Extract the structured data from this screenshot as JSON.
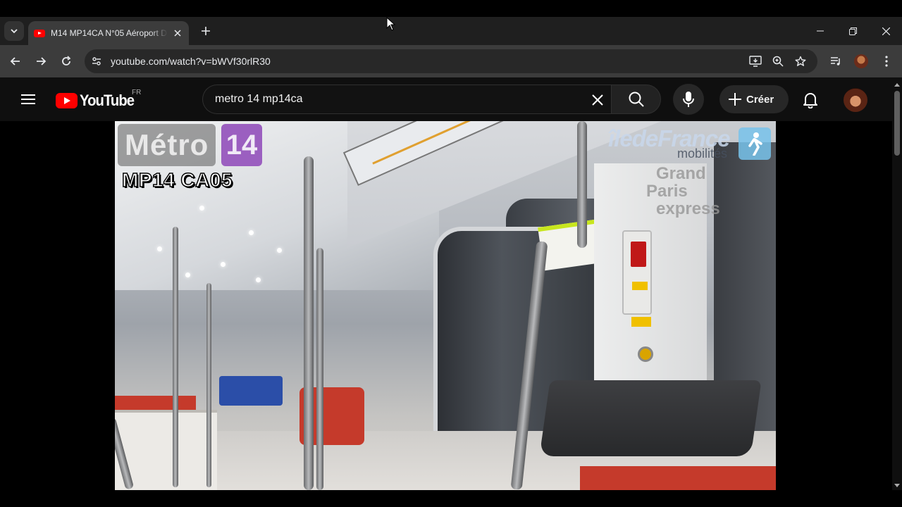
{
  "browser": {
    "tab_title": "M14 MP14CA N°05 Aéroport D",
    "url": "youtube.com/watch?v=bWVf30rlR30"
  },
  "youtube": {
    "logo_text": "YouTube",
    "region": "FR",
    "search_query": "metro 14 mp14ca",
    "create_label": "Créer"
  },
  "video": {
    "overlay_title": "Métro",
    "overlay_line": "14",
    "overlay_code": "MP14 CA05",
    "logo_brand": "îledeFrance",
    "logo_sub": "mobilités",
    "logo_gpe": [
      "Grand",
      "Paris",
      "express"
    ]
  },
  "colors": {
    "brand_red": "#ff0000",
    "line14_purple": "#9b5fc0",
    "background": "#0f0f0f"
  }
}
